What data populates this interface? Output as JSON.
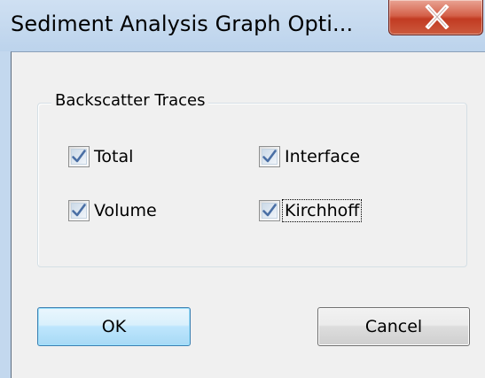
{
  "window": {
    "title": "Sediment Analysis Graph Opti...",
    "close_label": "X"
  },
  "group": {
    "label": "Backscatter Traces",
    "checkboxes": [
      {
        "label": "Total",
        "checked": true
      },
      {
        "label": "Interface",
        "checked": true
      },
      {
        "label": "Volume",
        "checked": true
      },
      {
        "label": "Kirchhoff",
        "checked": true,
        "focused": true
      }
    ]
  },
  "buttons": {
    "ok_label": "OK",
    "cancel_label": "Cancel"
  },
  "colors": {
    "titlebar": "#c3d8ee",
    "close_button": "#c8452c",
    "checkmark": "#4a6fa5",
    "ok_border": "#3c7fb1"
  }
}
